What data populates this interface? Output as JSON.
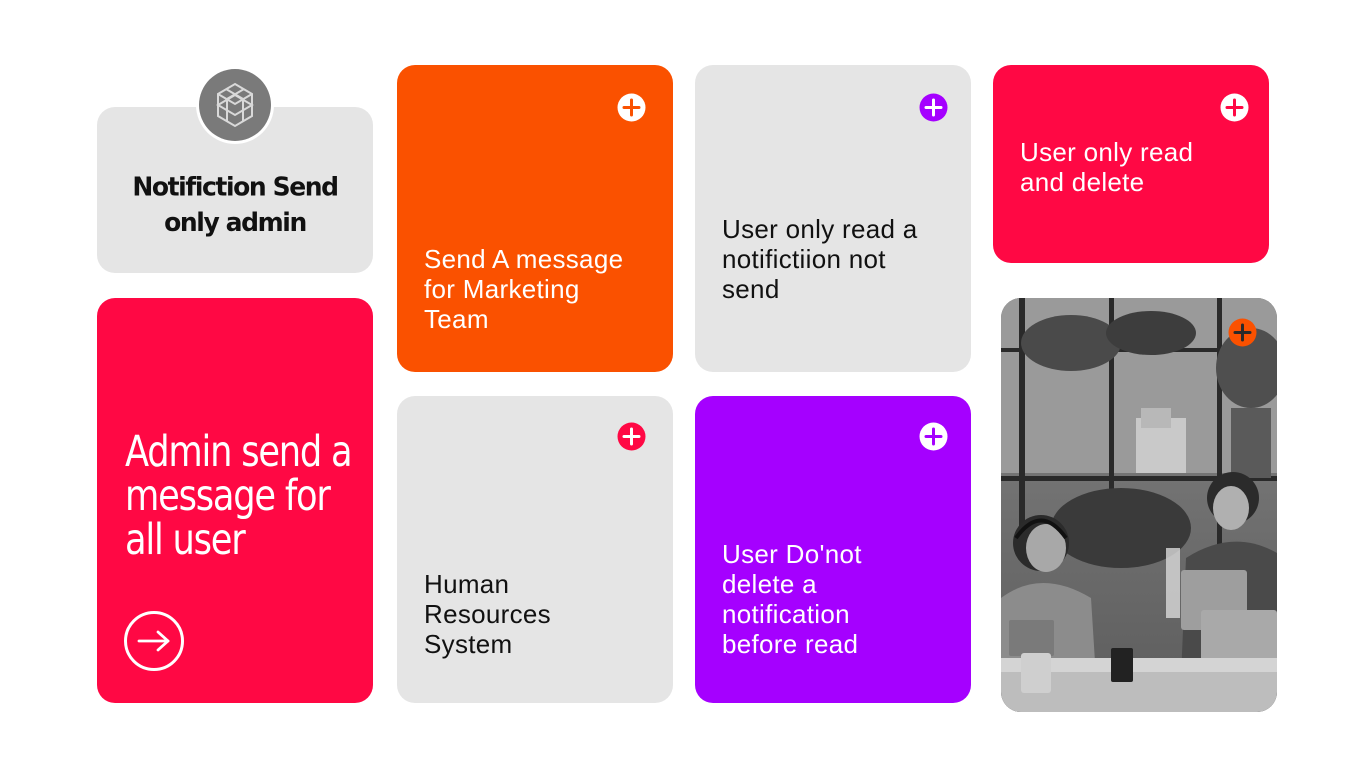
{
  "title_card": {
    "title_line1": "Notifiction Send",
    "title_line2": "only admin",
    "logo_icon": "cube-knot-logo-icon"
  },
  "admin_card": {
    "line1": "Admin send a",
    "line2": "message for",
    "line3": "all user",
    "arrow_icon": "arrow-right-circle-icon",
    "color": "#ff0844"
  },
  "marketing_card": {
    "line1": "Send A message",
    "line2": "for Marketing",
    "line3": "Team",
    "color": "#fa5100"
  },
  "read_card": {
    "line1": "User only read a",
    "line2": "notifictiion not",
    "line3": "send",
    "color": "#e5e5e5",
    "plus_color": "#a500ff"
  },
  "delete_card": {
    "line1": "User only read",
    "line2": "and delete",
    "color": "#ff0844"
  },
  "hr_card": {
    "line1": "Human",
    "line2": "Resources",
    "line3": "System",
    "color": "#e5e5e5",
    "plus_color": "#ff0844"
  },
  "purple_card": {
    "line1": "User Do'not",
    "line2": "delete a",
    "line3": "notification",
    "line4": "before read",
    "color": "#a500ff"
  },
  "photo_card": {
    "description_icon": "office-photo",
    "plus_color": "#fa5100"
  }
}
